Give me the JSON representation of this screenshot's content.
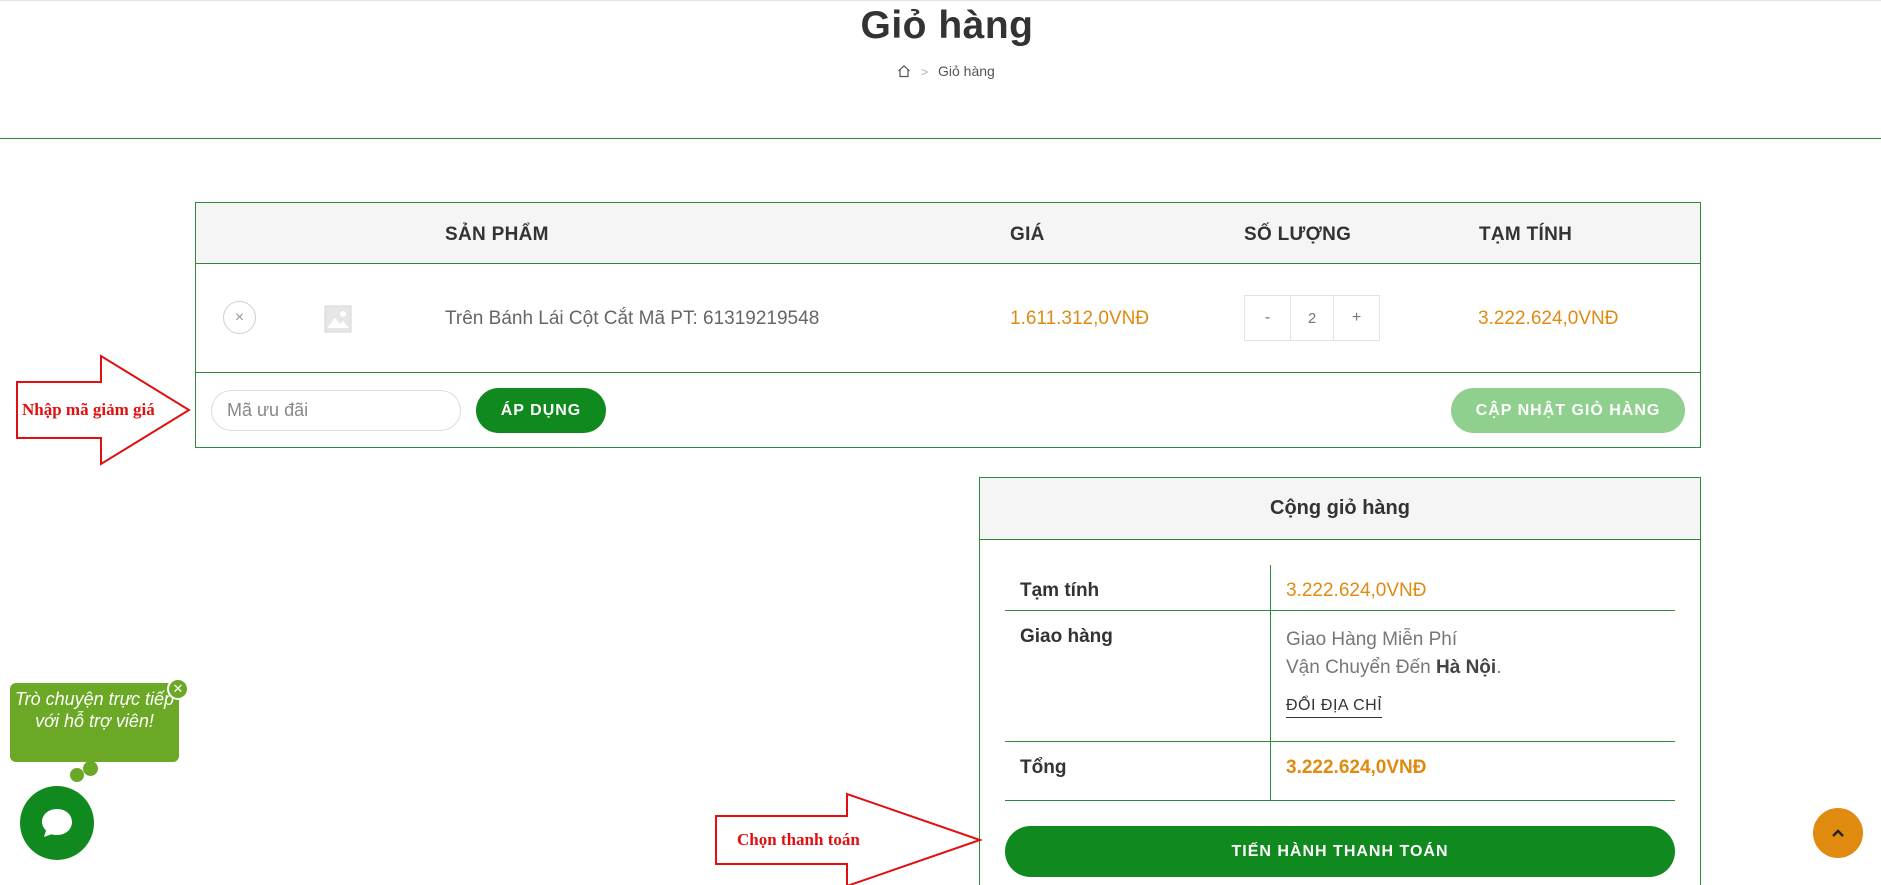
{
  "page": {
    "title": "Giỏ hàng"
  },
  "breadcrumb": {
    "home_icon": "home-icon",
    "separator": ">",
    "current": "Giỏ hàng"
  },
  "cart": {
    "headers": {
      "product": "SẢN PHẨM",
      "price": "GIÁ",
      "quantity": "SỐ LƯỢNG",
      "subtotal": "TẠM TÍNH"
    },
    "items": [
      {
        "name": "Trên Bánh Lái Cột Cắt Mã PT: 61319219548",
        "price": "1.611.312,0VNĐ",
        "quantity": "2",
        "subtotal": "3.222.624,0VNĐ",
        "remove_icon": "close-icon",
        "thumbnail_icon": "image-placeholder-icon"
      }
    ],
    "qty_minus": "-",
    "qty_plus": "+",
    "coupon_placeholder": "Mã ưu đãi",
    "apply_label": "ÁP DỤNG",
    "update_label": "CẬP NHẬT GIỎ HÀNG"
  },
  "totals": {
    "heading": "Cộng giỏ hàng",
    "subtotal_label": "Tạm tính",
    "subtotal_value": "3.222.624,0VNĐ",
    "shipping_label": "Giao hàng",
    "shipping_line1": "Giao Hàng Miễn Phí",
    "shipping_line2_prefix": "Vận Chuyển Đến",
    "shipping_city": "Hà Nội",
    "shipping_line2_suffix": ".",
    "change_address": "ĐỔI ĐỊA CHỈ",
    "total_label": "Tổng",
    "total_value": "3.222.624,0VNĐ",
    "checkout_label": "TIẾN HÀNH THANH TOÁN"
  },
  "annotations": {
    "coupon_hint": "Nhập mã giảm giá",
    "checkout_hint": "Chọn thanh toán"
  },
  "chat": {
    "bubble_text": "Trò chuyện trực tiếp với hỗ trợ viên!",
    "close_icon": "close-icon",
    "launcher_icon": "chat-icon"
  },
  "back_to_top_icon": "chevron-up-icon",
  "colors": {
    "accent_green": "#10891f",
    "border_green": "#2c8a3a",
    "price_orange": "#e08a10",
    "annotation_red": "#e01010",
    "chat_green": "#6aa825"
  }
}
